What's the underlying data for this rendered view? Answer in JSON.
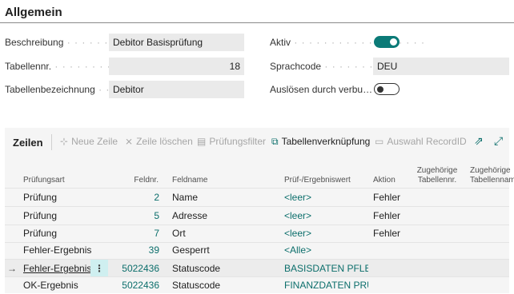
{
  "section": {
    "title": "Allgemein"
  },
  "fields": {
    "beschreibung": {
      "label": "Beschreibung",
      "value": "Debitor Basisprüfung"
    },
    "tabellennr": {
      "label": "Tabellennr.",
      "value": "18"
    },
    "tabellenbezeichnung": {
      "label": "Tabellenbezeichnung",
      "value": "Debitor"
    },
    "aktiv": {
      "label": "Aktiv",
      "state": "on"
    },
    "sprachcode": {
      "label": "Sprachcode",
      "value": "DEU"
    },
    "ausloesen": {
      "label": "Auslösen durch verbu…",
      "state": "off"
    }
  },
  "lines": {
    "title": "Zeilen",
    "toolbar": {
      "neue_zeile": "Neue Zeile",
      "zeile_loeschen": "Zeile löschen",
      "pruefungsfilter": "Prüfungsfilter",
      "tabellenverknuepfung": "Tabellenverknüpfung",
      "auswahl_recordid": "Auswahl RecordID"
    },
    "columns": {
      "pruefungsart": "Prüfungsart",
      "feldnr": "Feldnr.",
      "feldname": "Feldname",
      "pruefwert": "Prüf-/Ergebniswert",
      "aktion": "Aktion",
      "zug_tabellennr_1": "Zugehörige",
      "zug_tabellennr_2": "Tabellennr.",
      "zug_tabellenname_1": "Zugehörige",
      "zug_tabellenname_2": "Tabellennam"
    },
    "rows": [
      {
        "pruefungsart": "Prüfung",
        "feldnr": "2",
        "feldname": "Name",
        "wert": "<leer>",
        "aktion": "Fehler"
      },
      {
        "pruefungsart": "Prüfung",
        "feldnr": "5",
        "feldname": "Adresse",
        "wert": "<leer>",
        "aktion": "Fehler"
      },
      {
        "pruefungsart": "Prüfung",
        "feldnr": "7",
        "feldname": "Ort",
        "wert": "<leer>",
        "aktion": "Fehler"
      },
      {
        "pruefungsart": "Fehler-Ergebnis",
        "feldnr": "39",
        "feldname": "Gesperrt",
        "wert": "<Alle>",
        "aktion": ""
      },
      {
        "pruefungsart": "Fehler-Ergebnis",
        "feldnr": "5022436",
        "feldname": "Statuscode",
        "wert": "BASISDATEN PFLEG…",
        "aktion": ""
      },
      {
        "pruefungsart": "OK-Ergebnis",
        "feldnr": "5022436",
        "feldname": "Statuscode",
        "wert": "FINANZDATEN PRÜ…",
        "aktion": ""
      }
    ]
  },
  "colors": {
    "accent": "#0b7a77",
    "link": "#0b6e6b"
  }
}
